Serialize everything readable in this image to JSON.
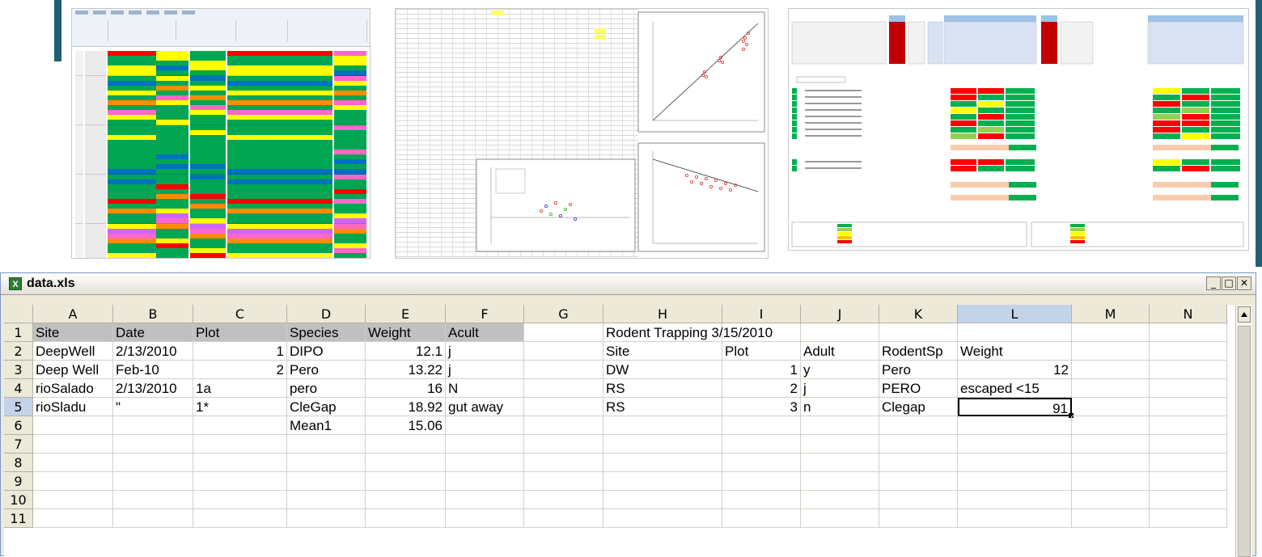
{
  "window": {
    "title": "data.xls",
    "icon": "excel-icon",
    "buttons": {
      "minimize": "_",
      "maximize": "□",
      "close": "✕"
    }
  },
  "columns": [
    "",
    "A",
    "B",
    "C",
    "D",
    "E",
    "F",
    "G",
    "H",
    "I",
    "J",
    "K",
    "L",
    "M",
    "N"
  ],
  "active_column": "L",
  "active_row": "5",
  "rows": [
    {
      "num": "1",
      "cells": {
        "A": "Site",
        "B": "Date",
        "C": "Plot",
        "D": "Species",
        "E": "Weight",
        "F": "Acult",
        "H": "Rodent Trapping 3/15/2010"
      }
    },
    {
      "num": "2",
      "cells": {
        "A": "DeepWell",
        "B": "2/13/2010",
        "C": "1",
        "D": "DIPO",
        "E": "12.1",
        "F": "j",
        "H": "Site",
        "I": "Plot",
        "J": "Adult",
        "K": "RodentSp",
        "L": "Weight"
      }
    },
    {
      "num": "3",
      "cells": {
        "A": "Deep Well",
        "B": "Feb-10",
        "C": "2",
        "D": "Pero",
        "E": "13.22",
        "F": "j",
        "H": "DW",
        "I": "1",
        "J": "y",
        "K": "Pero",
        "L": "12"
      }
    },
    {
      "num": "4",
      "cells": {
        "A": "rioSalado",
        "B": "2/13/2010",
        "C": "1a",
        "D": "pero",
        "E": "16",
        "F": "N",
        "H": "RS",
        "I": "2",
        "J": "j",
        "K": "PERO",
        "L": "escaped <15"
      }
    },
    {
      "num": "5",
      "cells": {
        "A": "rioSladu",
        "B": "\"",
        "C": "1*",
        "D": "CleGap",
        "E": "18.92",
        "F": "gut away",
        "H": "RS",
        "I": "3",
        "J": "n",
        "K": "Clegap",
        "L": "91"
      }
    },
    {
      "num": "6",
      "cells": {
        "D": "Mean1",
        "E": "15.06"
      }
    },
    {
      "num": "7",
      "cells": {}
    },
    {
      "num": "8",
      "cells": {}
    },
    {
      "num": "9",
      "cells": {}
    },
    {
      "num": "10",
      "cells": {}
    },
    {
      "num": "11",
      "cells": {}
    }
  ],
  "colors": {
    "accent": "#1f5f6f",
    "header_fill": "#c0c0c0",
    "active_header": "#c5d3ea"
  }
}
